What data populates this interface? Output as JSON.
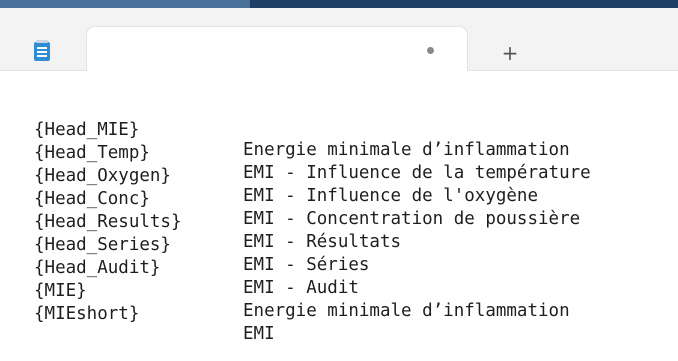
{
  "tab": {
    "title": "",
    "unsaved_indicator": "dot",
    "new_tab_label": "+"
  },
  "colors": {
    "titlebar_accent": "#1f3f66",
    "tabbar_bg": "#f3f3f3",
    "app_icon": "#2c8fd6"
  },
  "icons": {
    "app": "notepad-icon",
    "new_tab": "plus-icon",
    "modified": "dot-icon"
  },
  "editor": {
    "lines": [
      {
        "key": "{Head_MIE}",
        "value": "Energie minimale d’inflammation"
      },
      {
        "key": "{Head_Temp}",
        "value": "EMI - Influence de la température"
      },
      {
        "key": "{Head_Oxygen}",
        "value": "EMI - Influence de l'oxygène"
      },
      {
        "key": "{Head_Conc}",
        "value": "EMI - Concentration de poussière"
      },
      {
        "key": "{Head_Results}",
        "value": "EMI - Résultats"
      },
      {
        "key": "{Head_Series}",
        "value": "EMI - Séries"
      },
      {
        "key": "{Head_Audit}",
        "value": "EMI - Audit"
      },
      {
        "key": "{MIE}",
        "value": "Energie minimale d’inflammation"
      },
      {
        "key": "{MIEshort}",
        "value": "EMI"
      }
    ]
  }
}
